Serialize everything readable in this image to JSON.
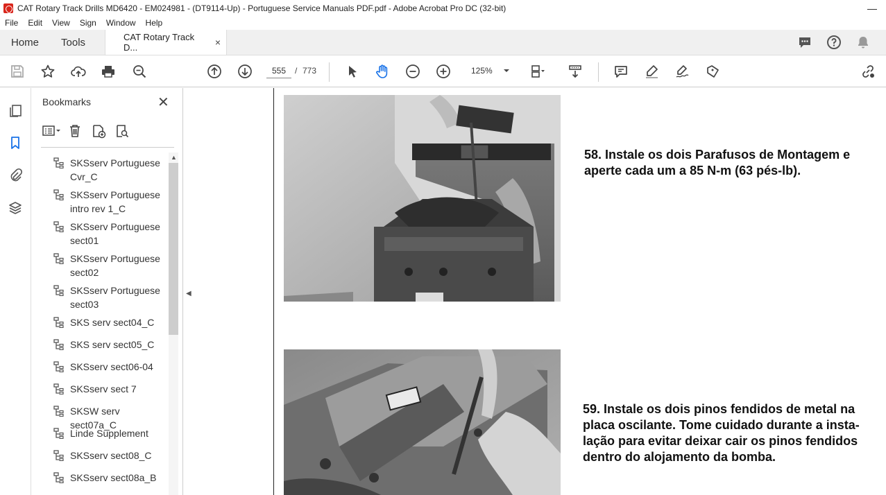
{
  "window": {
    "title": "CAT Rotary Track Drills MD6420 - EM024981 - (DT9114-Up) - Portuguese Service Manuals PDF.pdf - Adobe Acrobat Pro DC (32-bit)",
    "minimize_glyph": "—"
  },
  "menu": [
    "File",
    "Edit",
    "View",
    "Sign",
    "Window",
    "Help"
  ],
  "tabs": {
    "home": "Home",
    "tools": "Tools",
    "document": "CAT Rotary Track D...",
    "close_glyph": "×"
  },
  "toolbar": {
    "current_page": "555",
    "page_separator": "/",
    "total_pages": "773",
    "zoom": "125%"
  },
  "bookmarks": {
    "header": "Bookmarks",
    "close_glyph": "✕",
    "items": [
      {
        "label": "SKSserv Portuguese Cvr_C"
      },
      {
        "label": "SKSserv Portuguese intro rev 1_C"
      },
      {
        "label": "SKSserv Portuguese sect01"
      },
      {
        "label": "SKSserv Portuguese sect02"
      },
      {
        "label": "SKSserv Portuguese sect03"
      },
      {
        "label": "SKS serv sect04_C"
      },
      {
        "label": "SKS serv sect05_C"
      },
      {
        "label": "SKSserv sect06-04"
      },
      {
        "label": "SKSserv sect 7"
      },
      {
        "label": "SKSW serv sect07a_C"
      },
      {
        "label": "Linde Supplement"
      },
      {
        "label": "SKSserv sect08_C"
      },
      {
        "label": "SKSserv sect08a_B"
      }
    ]
  },
  "document": {
    "step58": "58. Instale os dois Parafusos de Montagem e aperte cada um a 85 N-m (63 pés-lb).",
    "step59": "59. Instale os dois pinos fendidos de metal na placa oscilante. Tome cuidado durante a insta-lação para evitar deixar cair os pinos fendidos dentro do alojamento da bomba."
  },
  "colors": {
    "accent": "#1a73e8",
    "brand_red": "#d9261c",
    "toolbar_bg": "#f0f0f0"
  }
}
